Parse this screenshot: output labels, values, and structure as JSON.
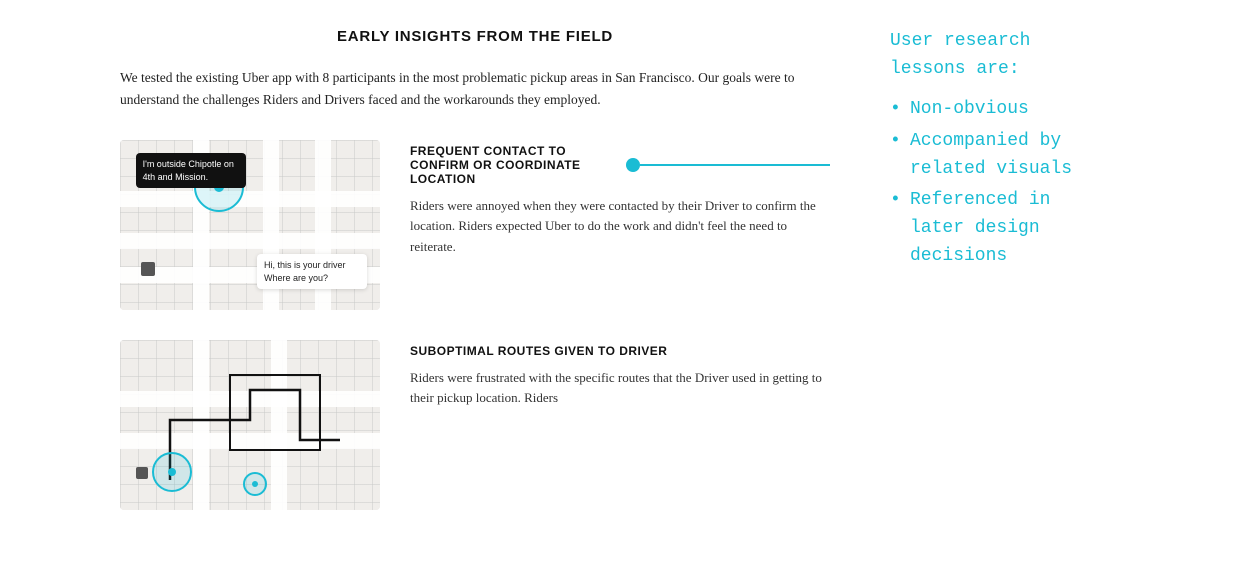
{
  "page": {
    "title": "EARLY INSIGHTS FROM THE FIELD",
    "intro": "We tested the existing Uber app with 8 participants in the most problematic pickup areas in San Francisco.\nOur goals were to understand the challenges Riders and Drivers faced and the workarounds they employed."
  },
  "insights": [
    {
      "id": "insight-1",
      "heading": "FREQUENT CONTACT TO CONFIRM OR COORDINATE LOCATION",
      "body": "Riders were annoyed when they were contacted by their Driver to confirm the location. Riders expected Uber to do the work and didn't feel the need to reiterate.",
      "bubble1": "I'm outside Chipotle on 4th and Mission.",
      "bubble2": "Hi, this is your driver Where are you?"
    },
    {
      "id": "insight-2",
      "heading": "SUBOPTIMAL ROUTES GIVEN TO DRIVER",
      "body": "Riders were frustrated with the specific routes that the Driver used in getting to their pickup location. Riders"
    }
  ],
  "annotation": {
    "intro": "User research\nlessons are:",
    "items": [
      "Non-obvious",
      "Accompanied by\nrelated visuals",
      "Referenced in\nlater design\ndecisions"
    ]
  }
}
